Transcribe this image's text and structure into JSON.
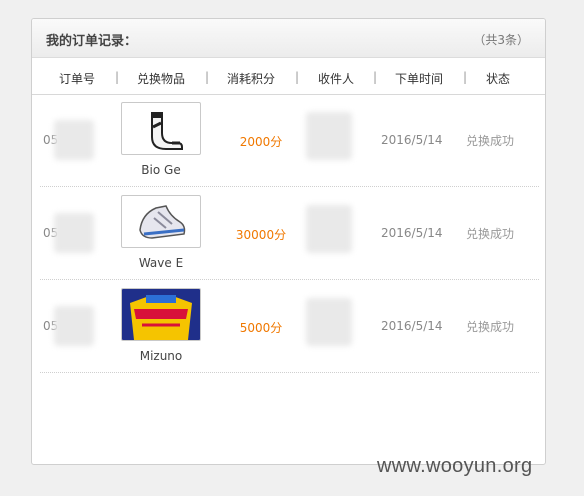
{
  "panel": {
    "title": "我的订单记录：",
    "count": "（共3条）"
  },
  "columns": {
    "order_no": "订单号",
    "item": "兑换物品",
    "points": "消耗积分",
    "receiver": "收件人",
    "order_time": "下单时间",
    "status": "状态"
  },
  "orders": [
    {
      "order_id": "05 13",
      "item_name": "Bio Ge",
      "points": "2000分",
      "date": "2016/5/14",
      "status": "兑换成功",
      "image": "sock-icon"
    },
    {
      "order_id": "05 3",
      "item_name": "Wave E",
      "points": "30000分",
      "date": "2016/5/14",
      "status": "兑换成功",
      "image": "running-shoe-icon"
    },
    {
      "order_id": "05 59",
      "item_name": "Mizuno",
      "points": "5000分",
      "date": "2016/5/14",
      "status": "兑换成功",
      "image": "jersey-icon"
    }
  ],
  "watermark": "www.wooyun.org",
  "colors": {
    "points": "#f07800",
    "status": "#999999"
  }
}
